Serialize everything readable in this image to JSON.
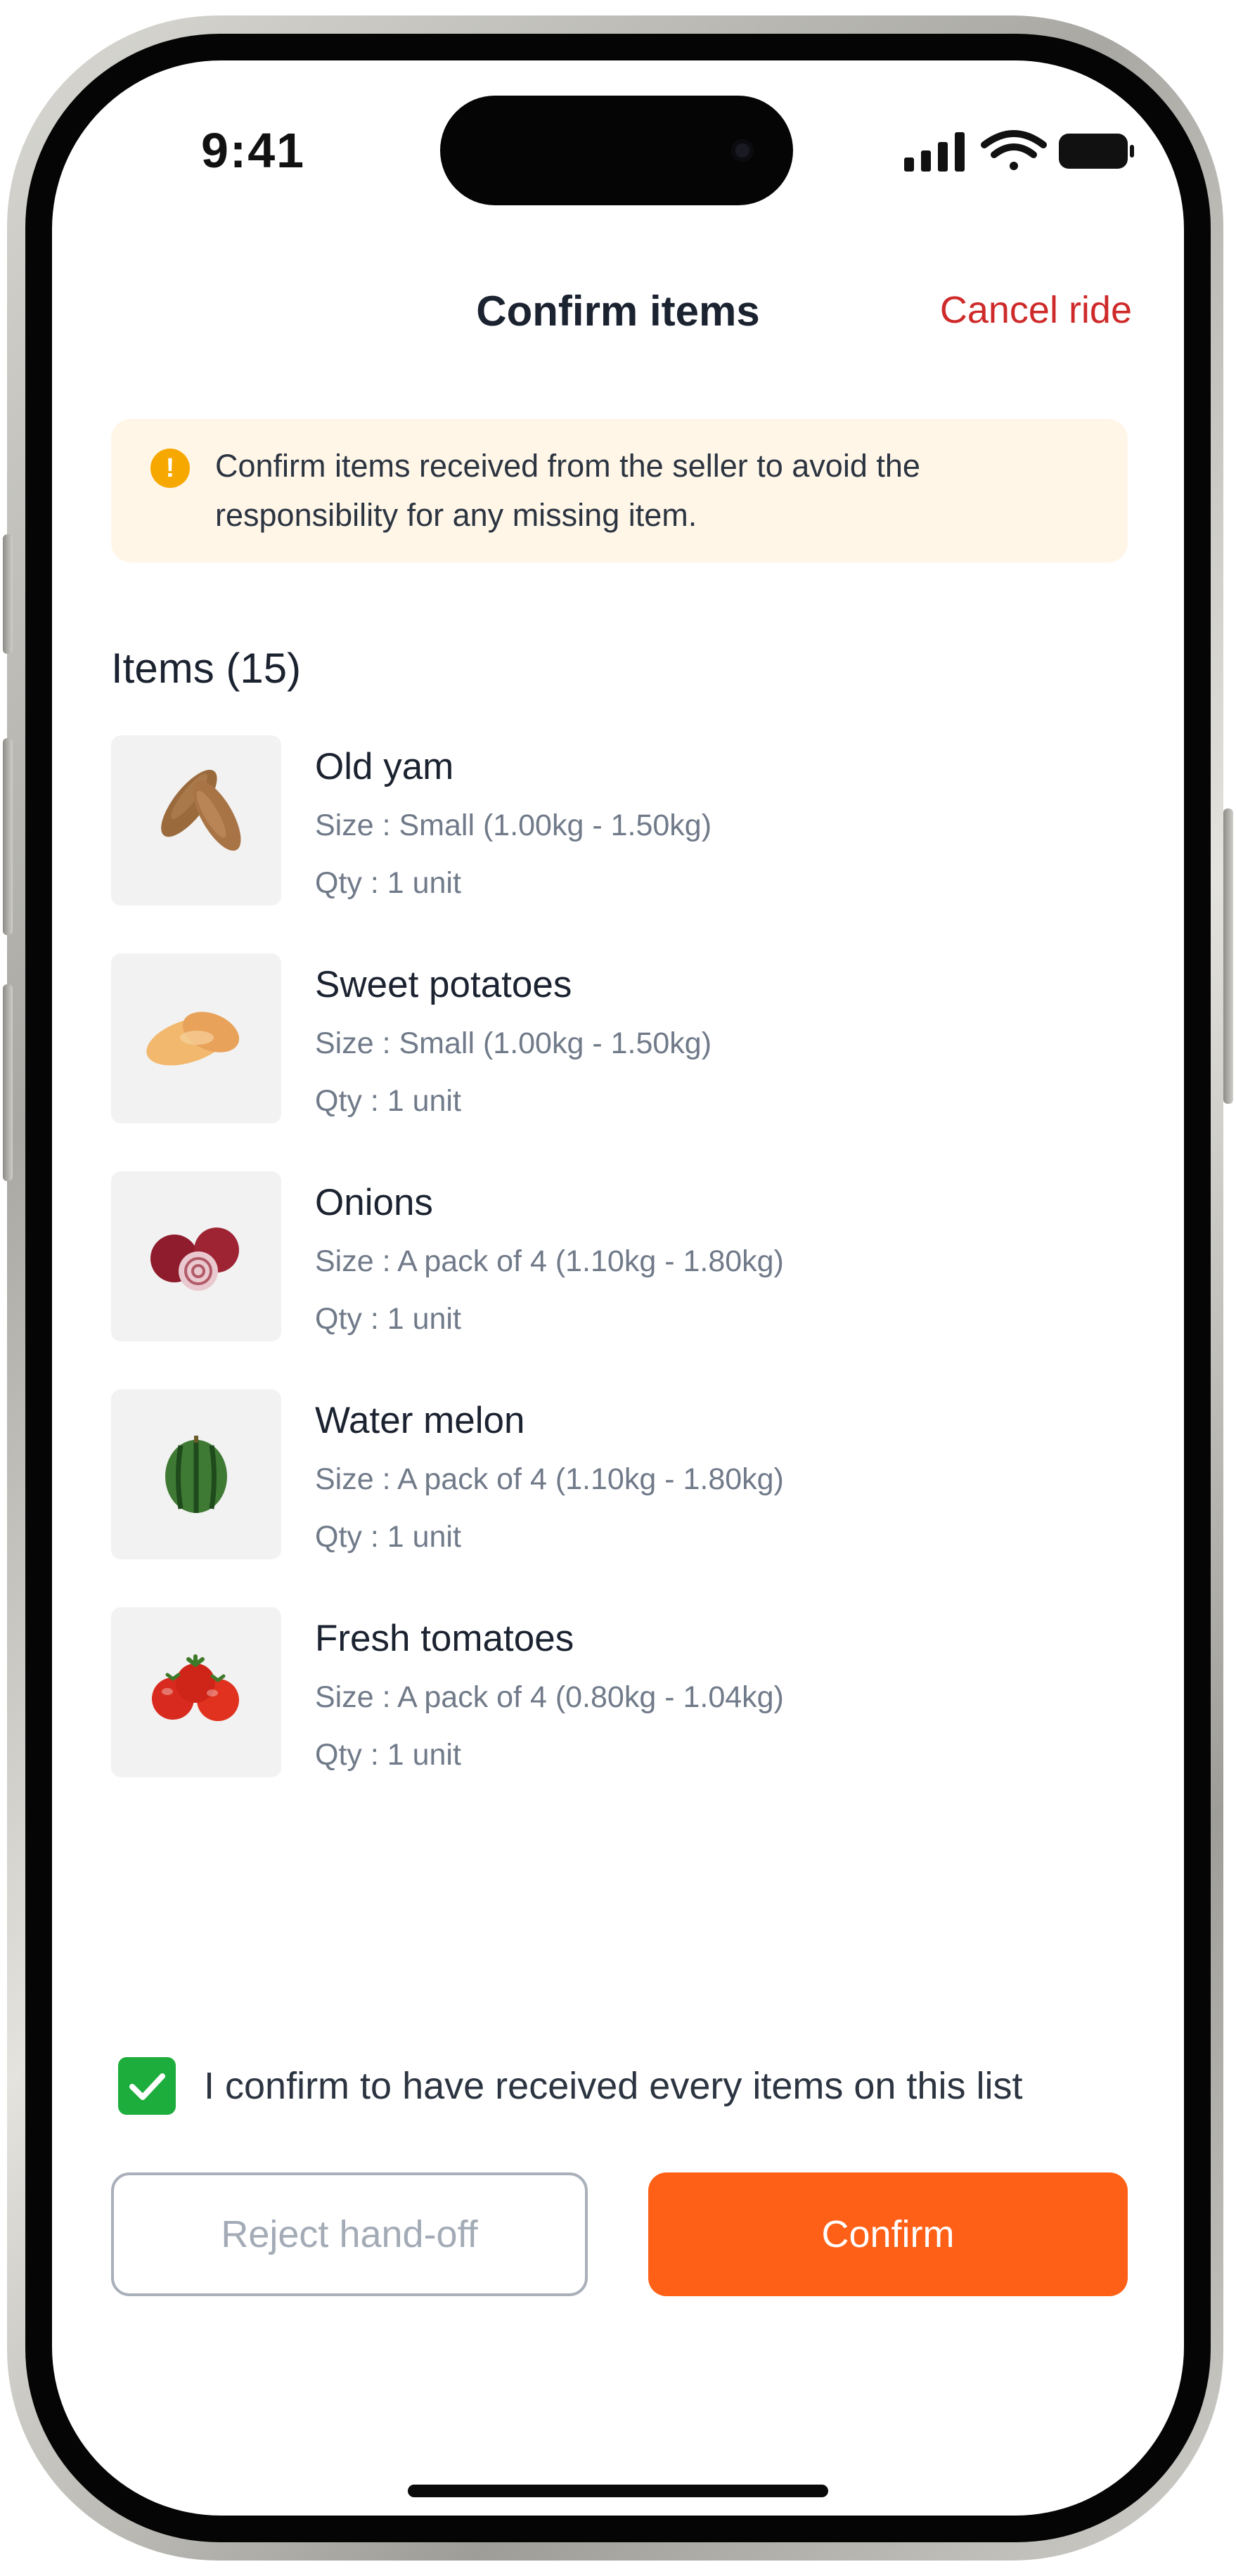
{
  "status_bar": {
    "time": "9:41"
  },
  "header": {
    "title": "Confirm items",
    "cancel_label": "Cancel ride"
  },
  "banner": {
    "icon": "warning-icon",
    "icon_glyph": "!",
    "text": "Confirm items received from the seller to avoid the responsibility for any missing item."
  },
  "items_heading": "Items (15)",
  "items": [
    {
      "name": "Old yam",
      "size": "Size : Small (1.00kg - 1.50kg)",
      "qty": "Qty : 1 unit",
      "icon": "yam-image"
    },
    {
      "name": "Sweet potatoes",
      "size": "Size : Small (1.00kg - 1.50kg)",
      "qty": "Qty : 1 unit",
      "icon": "sweet-potato-image"
    },
    {
      "name": "Onions",
      "size": "Size : A pack of 4 (1.10kg - 1.80kg)",
      "qty": "Qty : 1 unit",
      "icon": "onion-image"
    },
    {
      "name": "Water melon",
      "size": "Size : A pack of 4 (1.10kg - 1.80kg)",
      "qty": "Qty : 1 unit",
      "icon": "watermelon-image"
    },
    {
      "name": "Fresh tomatoes",
      "size": "Size : A pack of 4 (0.80kg - 1.04kg)",
      "qty": "Qty : 1 unit",
      "icon": "tomato-image"
    }
  ],
  "confirmation": {
    "checked": true,
    "label": "I confirm to have received every items on this list"
  },
  "actions": {
    "reject_label": "Reject hand-off",
    "confirm_label": "Confirm"
  },
  "colors": {
    "accent": "#ff6017",
    "cancel": "#cf2a2a",
    "checkbox": "#1dad3c",
    "banner_bg": "#fff6e8",
    "warning": "#f7a800"
  }
}
